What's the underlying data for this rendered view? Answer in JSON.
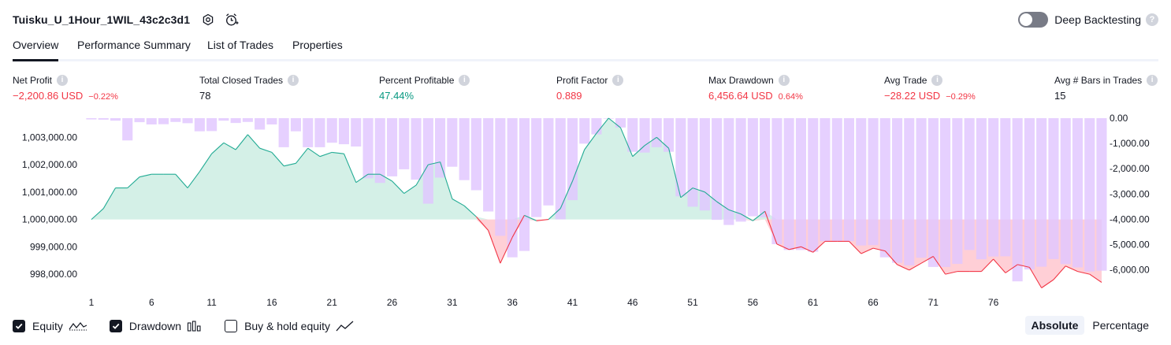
{
  "header": {
    "strategy_name": "Tuisku_U_1Hour_1WIL_43c2c3d1",
    "deep_backtesting_label": "Deep Backtesting",
    "deep_backtesting_on": false,
    "help_glyph": "?"
  },
  "tabs": [
    {
      "label": "Overview",
      "active": true
    },
    {
      "label": "Performance Summary",
      "active": false
    },
    {
      "label": "List of Trades",
      "active": false
    },
    {
      "label": "Properties",
      "active": false
    }
  ],
  "metrics": {
    "info_glyph": "i",
    "net_profit": {
      "label": "Net Profit",
      "value": "−2,200.86 USD",
      "sub": "−0.22%"
    },
    "total_closed_trades": {
      "label": "Total Closed Trades",
      "value": "78"
    },
    "percent_profitable": {
      "label": "Percent Profitable",
      "value": "47.44%"
    },
    "profit_factor": {
      "label": "Profit Factor",
      "value": "0.889"
    },
    "max_drawdown": {
      "label": "Max Drawdown",
      "value": "6,456.64 USD",
      "sub": "0.64%"
    },
    "avg_trade": {
      "label": "Avg Trade",
      "value": "−28.22 USD",
      "sub": "−0.29%"
    },
    "avg_bars": {
      "label": "Avg # Bars in Trades",
      "value": "15"
    }
  },
  "chart_data": {
    "type": "area",
    "x": [
      1,
      2,
      3,
      4,
      5,
      6,
      7,
      8,
      9,
      10,
      11,
      12,
      13,
      14,
      15,
      16,
      17,
      18,
      19,
      20,
      21,
      22,
      23,
      24,
      25,
      26,
      27,
      28,
      29,
      30,
      31,
      32,
      33,
      34,
      35,
      36,
      37,
      38,
      39,
      40,
      41,
      42,
      43,
      44,
      45,
      46,
      47,
      48,
      49,
      50,
      51,
      52,
      53,
      54,
      55,
      56,
      57,
      58,
      59,
      60,
      61,
      62,
      63,
      64,
      65,
      66,
      67,
      68,
      69,
      70,
      71,
      72,
      73,
      74,
      75,
      76,
      77,
      78,
      79
    ],
    "x_ticks": [
      "1",
      "6",
      "11",
      "16",
      "21",
      "26",
      "31",
      "36",
      "41",
      "46",
      "51",
      "56",
      "61",
      "66",
      "71",
      "76"
    ],
    "left_ticks": [
      "1,003,000.00",
      "1,002,000.00",
      "1,001,000.00",
      "1,000,000.00",
      "999,000.00",
      "998,000.00"
    ],
    "right_ticks": [
      "0.00",
      "-1,000.00",
      "-2,000.00",
      "-3,000.00",
      "-4,000.00",
      "-5,000.00",
      "-6,000.00"
    ],
    "left_ylim": [
      997600,
      1003700
    ],
    "right_ylim": [
      -6600,
      0
    ],
    "baseline": 1000000,
    "series": [
      {
        "name": "Equity",
        "axis": "left",
        "values": [
          1000000,
          1000400,
          1001150,
          1001150,
          1001550,
          1001650,
          1001650,
          1001650,
          1001150,
          1001750,
          1002400,
          1002800,
          1002550,
          1003100,
          1002600,
          1002450,
          1001950,
          1002050,
          1002600,
          1002300,
          1002450,
          1002400,
          1001350,
          1001650,
          1001650,
          1001400,
          1000950,
          1001250,
          1002000,
          1002100,
          1000750,
          1000500,
          1000100,
          999600,
          998400,
          999350,
          1000150,
          999950,
          1000000,
          1000400,
          1001400,
          1002550,
          1003150,
          1003700,
          1003350,
          1002300,
          1002700,
          1003000,
          1002600,
          1000800,
          1001150,
          1001000,
          1000650,
          1000350,
          1000200,
          999950,
          1000300,
          999100,
          998900,
          999000,
          998800,
          999200,
          999200,
          999200,
          998750,
          998950,
          998850,
          998350,
          998150,
          998400,
          998650,
          998000,
          998100,
          998100,
          998100,
          998550,
          998050,
          998350,
          998250,
          997500,
          997800,
          998300,
          998100,
          998000,
          997700
        ]
      },
      {
        "name": "Drawdown",
        "axis": "right",
        "values": [
          -50,
          -60,
          -100,
          -880,
          -160,
          -250,
          -240,
          -150,
          -200,
          -520,
          -510,
          -100,
          -190,
          -150,
          -450,
          -250,
          -1150,
          -520,
          -1150,
          -1150,
          -970,
          -1030,
          -1120,
          -2380,
          -2560,
          -2300,
          -2020,
          -2430,
          -3380,
          -2350,
          -1920,
          -2450,
          -2850,
          -3690,
          -4650,
          -5500,
          -5250,
          -3910,
          -3450,
          -4000,
          -3240,
          -1010,
          -640,
          0,
          -370,
          -1330,
          -1360,
          -1150,
          -1330,
          -3090,
          -3500,
          -3650,
          -4020,
          -4220,
          -4090,
          -3880,
          -3920,
          -4980,
          -5210,
          -5210,
          -5280,
          -4860,
          -4860,
          -4860,
          -5030,
          -5020,
          -5500,
          -5720,
          -5820,
          -5520,
          -5880,
          -5880,
          -5760,
          -5210,
          -5580,
          -5470,
          -5460,
          -6450,
          -5980,
          -5870,
          -5570,
          -5770,
          -5900,
          -6060,
          -6030
        ]
      }
    ]
  },
  "legend": {
    "equity_label": "Equity",
    "drawdown_label": "Drawdown",
    "buyhold_label": "Buy & hold equity",
    "equity_checked": true,
    "drawdown_checked": true,
    "buyhold_checked": false
  },
  "modes": {
    "absolute_label": "Absolute",
    "percentage_label": "Percentage",
    "active": "absolute"
  },
  "colors": {
    "positive": "#089981",
    "negative": "#f23645",
    "equity_fill": "#d4f0e7",
    "equity_line": "#22ab94",
    "loss_fill": "#ffcfd6",
    "drawdown_bar": "#e1c6ff",
    "drawdown_line": "#f23645"
  }
}
